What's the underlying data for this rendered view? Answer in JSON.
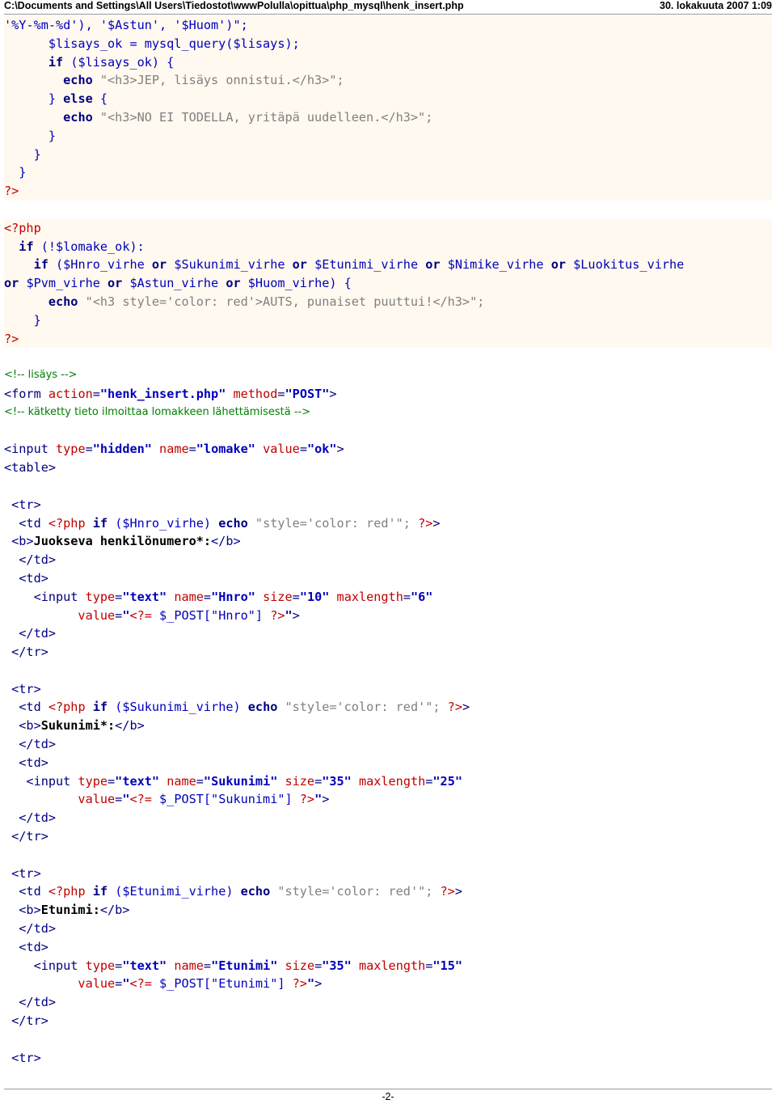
{
  "header": {
    "path": "C:\\Documents and Settings\\All Users\\Tiedostot\\wwwPolulla\\opittua\\php_mysql\\henk_insert.php",
    "date": "30. lokakuuta 2007 1:09"
  },
  "code": {
    "l1": "'%Y-%m-%d'), '$Astun', '$Huom')\";",
    "l2a": "      $lisays_ok = mysql_query($lisays);",
    "l3a": "      ",
    "l3b": "if",
    "l3c": " ($lisays_ok) {",
    "l4a": "        ",
    "l4b": "echo",
    "l4c": " \"<h3>JEP, lisäys onnistui.</h3>\";",
    "l5a": "      } ",
    "l5b": "else",
    "l5c": " {",
    "l6a": "        ",
    "l6b": "echo",
    "l6c": " \"<h3>NO EI TODELLA, yritäpä uudelleen.</h3>\";",
    "l7": "      }",
    "l8": "    }",
    "l9": "  }",
    "l10": "?>",
    "l12": "<?php",
    "l13a": "  ",
    "l13b": "if",
    "l13c": " (!$lomake_ok):",
    "l14a": "    ",
    "l14b": "if",
    "l14c": " ($Hnro_virhe ",
    "l14d": "or",
    "l14e": " $Sukunimi_virhe ",
    "l14f": "or",
    "l14g": " $Etunimi_virhe ",
    "l14h": "or",
    "l14i": " $Nimike_virhe ",
    "l14j": "or",
    "l14k": " $Luokitus_virhe",
    "l15a": "or",
    "l15b": " $Pvm_virhe ",
    "l15c": "or",
    "l15d": " $Astun_virhe ",
    "l15e": "or",
    "l15f": " $Huom_virhe) {",
    "l16a": "      ",
    "l16b": "echo",
    "l16c": " \"<h3 style='color: red'>AUTS, punaiset puuttui!</h3>\";",
    "l17": "    }",
    "l18": "?>",
    "l20": "<!-- lisäys -->",
    "l21a": "<form ",
    "l21b": "action",
    "l21c": "=",
    "l21d": "\"henk_insert.php\"",
    "l21e": " method",
    "l21f": "=",
    "l21g": "\"POST\"",
    "l21h": ">",
    "l22": "<!-- kätketty tieto ilmoittaa lomakkeen lähettämisestä -->",
    "l24a": "<input ",
    "l24b": "type",
    "l24c": "=",
    "l24d": "\"hidden\"",
    "l24e": " name",
    "l24f": "=",
    "l24g": "\"lomake\"",
    "l24h": " value",
    "l24i": "=",
    "l24j": "\"ok\"",
    "l24k": ">",
    "l25": "<table>",
    "l27": " <tr>",
    "l28a": "  <td ",
    "l28b": "<?php",
    "l28c": " ",
    "l28d": "if",
    "l28e": " ($Hnro_virhe) ",
    "l28f": "echo",
    "l28g": " \"style='color: red'\"; ",
    "l28h": "?>",
    "l28i": ">",
    "l29a": " <b>",
    "l29b": "Juokseva henkilönumero*:",
    "l29c": "</b>",
    "l30": "  </td>",
    "l31": "  <td>",
    "l32a": "    <input ",
    "l32b": "type",
    "l32c": "=",
    "l32d": "\"text\"",
    "l32e": " name",
    "l32f": "=",
    "l32g": "\"Hnro\"",
    "l32h": " size",
    "l32i": "=",
    "l32j": "\"10\"",
    "l32k": " maxlength",
    "l32l": "=",
    "l32m": "\"6\"",
    "l33a": "          value",
    "l33b": "=",
    "l33c": "\"",
    "l33d": "<?=",
    "l33e": " $_POST[\"Hnro\"] ",
    "l33f": "?>",
    "l33g": "\"",
    "l33h": ">",
    "l34": "  </td>",
    "l35": " </tr>",
    "l37": " <tr>",
    "l38a": "  <td ",
    "l38b": "<?php",
    "l38c": " ",
    "l38d": "if",
    "l38e": " ($Sukunimi_virhe) ",
    "l38f": "echo",
    "l38g": " \"style='color: red'\"; ",
    "l38h": "?>",
    "l38i": ">",
    "l39a": "  <b>",
    "l39b": "Sukunimi*:",
    "l39c": "</b>",
    "l40": "  </td>",
    "l41": "  <td>",
    "l42a": "   <input ",
    "l42b": "type",
    "l42c": "=",
    "l42d": "\"text\"",
    "l42e": " name",
    "l42f": "=",
    "l42g": "\"Sukunimi\"",
    "l42h": " size",
    "l42i": "=",
    "l42j": "\"35\"",
    "l42k": " maxlength",
    "l42l": "=",
    "l42m": "\"25\"",
    "l43a": "          value",
    "l43b": "=",
    "l43c": "\"",
    "l43d": "<?=",
    "l43e": " $_POST[\"Sukunimi\"] ",
    "l43f": "?>",
    "l43g": "\"",
    "l43h": ">",
    "l44": "  </td>",
    "l45": " </tr>",
    "l47": " <tr>",
    "l48a": "  <td ",
    "l48b": "<?php",
    "l48c": " ",
    "l48d": "if",
    "l48e": " ($Etunimi_virhe) ",
    "l48f": "echo",
    "l48g": " \"style='color: red'\"; ",
    "l48h": "?>",
    "l48i": ">",
    "l49a": "  <b>",
    "l49b": "Etunimi:",
    "l49c": "</b>",
    "l50": "  </td>",
    "l51": "  <td>",
    "l52a": "    <input ",
    "l52b": "type",
    "l52c": "=",
    "l52d": "\"text\"",
    "l52e": " name",
    "l52f": "=",
    "l52g": "\"Etunimi\"",
    "l52h": " size",
    "l52i": "=",
    "l52j": "\"35\"",
    "l52k": " maxlength",
    "l52l": "=",
    "l52m": "\"15\"",
    "l53a": "          value",
    "l53b": "=",
    "l53c": "\"",
    "l53d": "<?=",
    "l53e": " $_POST[\"Etunimi\"] ",
    "l53f": "?>",
    "l53g": "\"",
    "l53h": ">",
    "l54": "  </td>",
    "l55": " </tr>",
    "l57": " <tr>"
  },
  "footer": {
    "page": "-2-"
  }
}
